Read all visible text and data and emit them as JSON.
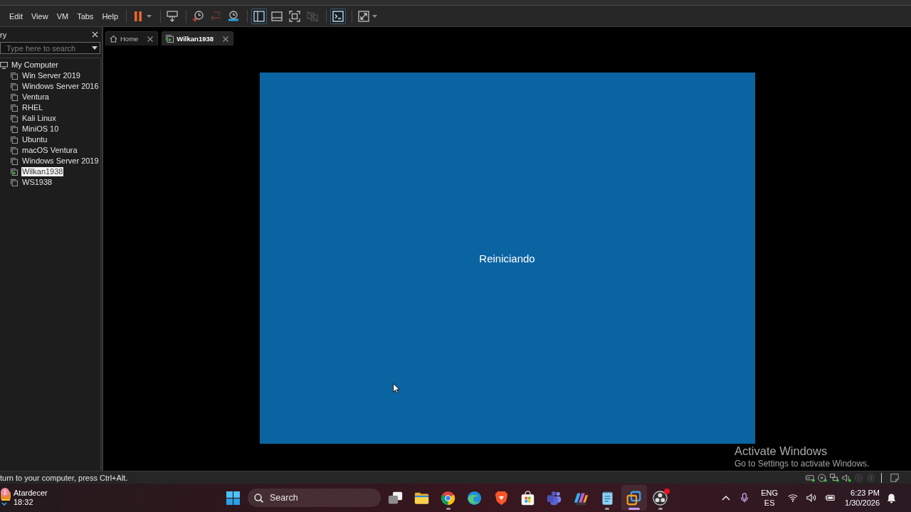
{
  "menu_bar": {
    "items": [
      "Edit",
      "View",
      "VM",
      "Tabs",
      "Help"
    ]
  },
  "toolbar": {
    "groups": [
      {
        "buttons": [
          {
            "kind": "pause",
            "selected": false,
            "disabled": false,
            "dropdown": true
          }
        ]
      },
      {
        "buttons": [
          {
            "kind": "sendkeys",
            "selected": false,
            "disabled": false,
            "dropdown": false
          }
        ]
      },
      {
        "buttons": [
          {
            "kind": "snapshot",
            "selected": false,
            "disabled": false,
            "dropdown": false
          },
          {
            "kind": "revert",
            "selected": false,
            "disabled": true,
            "dropdown": false
          },
          {
            "kind": "manager",
            "selected": false,
            "disabled": false,
            "dropdown": false
          }
        ]
      },
      {
        "buttons": [
          {
            "kind": "sidebar",
            "selected": true,
            "disabled": false,
            "dropdown": false
          },
          {
            "kind": "thumbnails",
            "selected": false,
            "disabled": false,
            "dropdown": false
          },
          {
            "kind": "fullscreen",
            "selected": false,
            "disabled": false,
            "dropdown": false
          },
          {
            "kind": "unity",
            "selected": false,
            "disabled": true,
            "dropdown": false
          }
        ]
      },
      {
        "buttons": [
          {
            "kind": "console",
            "selected": true,
            "disabled": false,
            "dropdown": false
          }
        ]
      },
      {
        "buttons": [
          {
            "kind": "stretch",
            "selected": false,
            "disabled": false,
            "dropdown": true
          }
        ]
      }
    ]
  },
  "sidebar": {
    "title": "ry",
    "search": {
      "placeholder": "Type here to search"
    },
    "tree": [
      {
        "label": "My Computer",
        "selected": false,
        "children": [
          {
            "label": "Win Server 2019",
            "selected": false,
            "running": false
          },
          {
            "label": "Windows Server 2016",
            "selected": false,
            "running": false
          },
          {
            "label": "Ventura",
            "selected": false,
            "running": false
          },
          {
            "label": "RHEL",
            "selected": false,
            "running": false
          },
          {
            "label": "Kali Linux",
            "selected": false,
            "running": false
          },
          {
            "label": "MiniOS 10",
            "selected": false,
            "running": false
          },
          {
            "label": "Ubuntu",
            "selected": false,
            "running": false
          },
          {
            "label": "macOS Ventura",
            "selected": false,
            "running": false
          },
          {
            "label": "Windows Server 2019",
            "selected": false,
            "running": false
          },
          {
            "label": "Wilkan1938",
            "selected": true,
            "running": true
          },
          {
            "label": "WS1938",
            "selected": false,
            "running": false
          }
        ]
      }
    ]
  },
  "tabs": [
    {
      "kind": "home",
      "label": "Home",
      "selected": false,
      "running": false
    },
    {
      "kind": "vm",
      "label": "Wilkan1938",
      "selected": true,
      "running": true
    }
  ],
  "vm_screen": {
    "message": "Reiniciando"
  },
  "activation_notice": {
    "title": "Activate Windows",
    "message": "Go to Settings to activate Windows."
  },
  "status_bar": {
    "message": "turn to your computer, press Ctrl+Alt.",
    "devices": [
      {
        "kind": "disk",
        "active": true
      },
      {
        "kind": "cd",
        "active": true
      },
      {
        "kind": "network",
        "active": true
      },
      {
        "kind": "sound",
        "active": true
      },
      {
        "kind": "usb",
        "active": false
      },
      {
        "kind": "bluetooth",
        "active": false
      }
    ]
  },
  "taskbar": {
    "weather": {
      "count": "1",
      "condition": "Atardecer",
      "time": "18:32"
    },
    "search": {
      "placeholder": "Search"
    },
    "apps": [
      {
        "kind": "taskview",
        "running": false,
        "selected": false,
        "alert": false
      },
      {
        "kind": "explorer",
        "running": false,
        "selected": false,
        "alert": false
      },
      {
        "kind": "chrome",
        "running": true,
        "selected": false,
        "alert": false
      },
      {
        "kind": "edge",
        "running": false,
        "selected": false,
        "alert": false
      },
      {
        "kind": "brave",
        "running": false,
        "selected": false,
        "alert": false
      },
      {
        "kind": "store",
        "running": false,
        "selected": false,
        "alert": false
      },
      {
        "kind": "teams",
        "running": false,
        "selected": false,
        "alert": false
      },
      {
        "kind": "copilot",
        "running": false,
        "selected": false,
        "alert": false
      },
      {
        "kind": "notepad",
        "running": true,
        "selected": false,
        "alert": false
      },
      {
        "kind": "vmware",
        "running": true,
        "selected": true,
        "alert": false
      },
      {
        "kind": "obs",
        "running": true,
        "selected": false,
        "alert": true
      }
    ],
    "tray": {
      "language": "ENG",
      "layout": "ES",
      "time": "6:23 PM",
      "date": "1/30/2026"
    }
  }
}
